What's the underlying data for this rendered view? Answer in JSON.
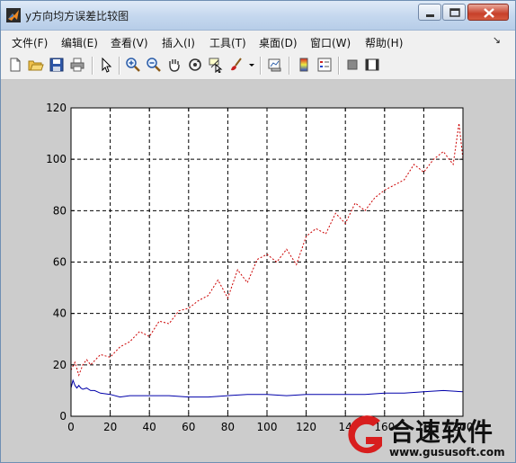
{
  "window": {
    "title": "y方向均方误差比较图",
    "controls": [
      "minimize-icon",
      "maximize-icon",
      "close-icon"
    ]
  },
  "menubar": {
    "items": [
      "文件(F)",
      "编辑(E)",
      "查看(V)",
      "插入(I)",
      "工具(T)",
      "桌面(D)",
      "窗口(W)",
      "帮助(H)"
    ],
    "overflow": "↘"
  },
  "toolbar": {
    "icons": [
      "new-figure-icon",
      "open-file-icon",
      "save-icon",
      "print-icon",
      "select-arrow-icon",
      "zoom-in-icon",
      "zoom-out-icon",
      "pan-hand-icon",
      "rotate-3d-icon",
      "data-cursor-icon",
      "brush-icon",
      "dropdown-arrow-icon",
      "link-plot-icon",
      "colorbar-icon",
      "legend-icon",
      "hide-plot-tools-icon",
      "show-plot-tools-icon"
    ]
  },
  "chart_data": {
    "type": "line",
    "xlim": [
      0,
      200
    ],
    "ylim": [
      0,
      120
    ],
    "xticks": [
      0,
      20,
      40,
      60,
      80,
      100,
      120,
      140,
      160,
      180,
      200
    ],
    "yticks": [
      0,
      20,
      40,
      60,
      80,
      100,
      120
    ],
    "xtick_labels": [
      "0",
      "20",
      "40",
      "60",
      "80",
      "100",
      "120",
      "14",
      "160",
      "18",
      "200"
    ],
    "ytick_labels": [
      "0",
      "20",
      "40",
      "60",
      "80",
      "100",
      "120"
    ],
    "grid": true,
    "series": [
      {
        "color": "#cc0000",
        "style": "dotted",
        "x": [
          0,
          2,
          4,
          6,
          8,
          10,
          15,
          20,
          25,
          30,
          35,
          40,
          45,
          50,
          55,
          60,
          65,
          70,
          75,
          80,
          85,
          90,
          95,
          100,
          105,
          110,
          115,
          120,
          125,
          130,
          135,
          140,
          145,
          150,
          155,
          160,
          165,
          170,
          175,
          180,
          185,
          190,
          195,
          198,
          200
        ],
        "y": [
          18,
          21,
          16,
          20,
          22,
          20,
          24,
          23,
          27,
          29,
          33,
          31,
          37,
          36,
          41,
          42,
          45,
          47,
          53,
          46,
          57,
          52,
          61,
          63,
          60,
          65,
          59,
          70,
          73,
          71,
          79,
          75,
          83,
          80,
          85,
          88,
          90,
          92,
          98,
          95,
          100,
          103,
          98,
          114,
          100
        ]
      },
      {
        "color": "#0000aa",
        "style": "solid",
        "x": [
          0,
          1,
          2,
          3,
          4,
          5,
          6,
          8,
          10,
          12,
          15,
          20,
          25,
          30,
          40,
          50,
          60,
          70,
          80,
          90,
          100,
          110,
          120,
          130,
          140,
          150,
          160,
          170,
          180,
          190,
          200
        ],
        "y": [
          11,
          14,
          12,
          11,
          12,
          11,
          10.5,
          11,
          10,
          10,
          9,
          8.5,
          7.5,
          8,
          8,
          8,
          7.5,
          7.5,
          8,
          8.5,
          8.5,
          8,
          8.5,
          8.5,
          8.5,
          8.5,
          9,
          9,
          9.5,
          10,
          9.5
        ]
      }
    ]
  },
  "watermark": {
    "name": "合速软件",
    "url": "www.gususoft.com"
  }
}
